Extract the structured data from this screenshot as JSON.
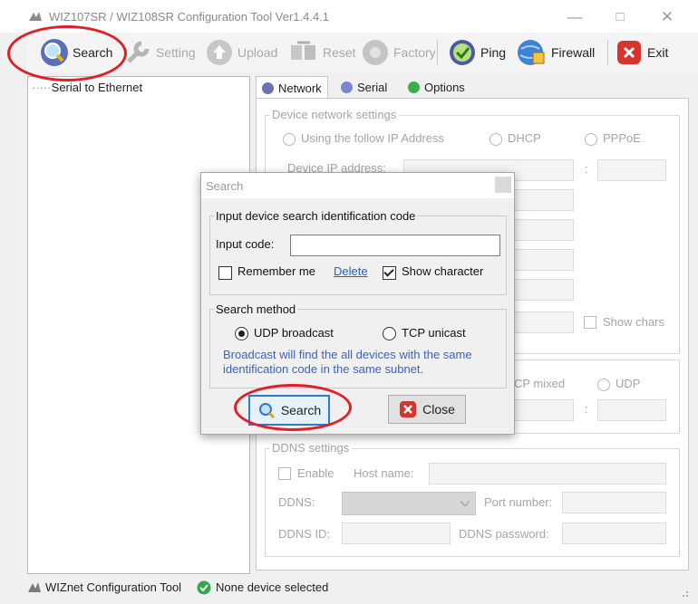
{
  "window": {
    "title": "WIZ107SR / WIZ108SR Configuration Tool Ver1.4.4.1",
    "controls": [
      "—",
      "□",
      "✕"
    ]
  },
  "toolbar": {
    "search": "Search",
    "setting": "Setting",
    "upload": "Upload",
    "reset": "Reset",
    "factory": "Factory",
    "ping": "Ping",
    "firewall": "Firewall",
    "exit": "Exit"
  },
  "tree": {
    "item": "Serial to Ethernet"
  },
  "tabs": {
    "network": "Network",
    "serial": "Serial",
    "options": "Options"
  },
  "network": {
    "device_settings_title": "Device network settings",
    "ip_mode": {
      "static": "Using the follow IP Address",
      "dhcp": "DHCP",
      "pppoe": "PPPoE"
    },
    "device_ip_label": "Device IP address:",
    "colon": ":",
    "show_chars": "Show chars",
    "mode": {
      "mixed": "CP mixed",
      "udp": "UDP"
    }
  },
  "ddns": {
    "title": "DDNS settings",
    "enable": "Enable",
    "host_name": "Host name:",
    "ddns": "DDNS:",
    "port_number": "Port number:",
    "ddns_id": "DDNS ID:",
    "ddns_password": "DDNS password:"
  },
  "status": {
    "app": "WIZnet Configuration Tool",
    "device": "None device selected"
  },
  "dialog": {
    "title": "Search",
    "id_group": "Input device search identification code",
    "input_label": "Input code:",
    "input_value": "",
    "remember": "Remember me",
    "delete": "Delete",
    "show_character": "Show character",
    "method_group": "Search method",
    "udp": "UDP broadcast",
    "tcp": "TCP unicast",
    "hint": "Broadcast will find the all devices with the same identification code in the same subnet.",
    "search_button": "Search",
    "close_button": "Close"
  },
  "colors": {
    "highlight_ring": "#e21f26",
    "hint_text": "#3a62c9",
    "link": "#1f5fd6"
  }
}
